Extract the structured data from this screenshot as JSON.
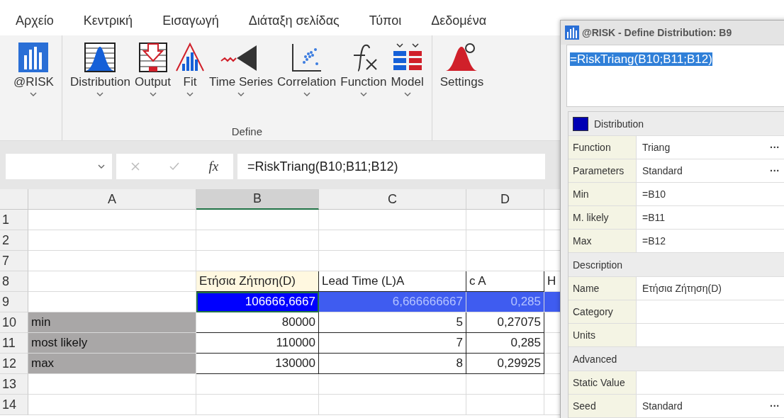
{
  "menu_tabs": [
    "Αρχείο",
    "Κεντρική",
    "Εισαγωγή",
    "Διάταξη σελίδας",
    "Τύποι",
    "Δεδομένα"
  ],
  "ribbon": {
    "buttons": [
      {
        "label": "@RISK",
        "dropdown": true
      },
      {
        "label": "Distribution",
        "dropdown": true
      },
      {
        "label": "Output",
        "dropdown": true
      },
      {
        "label": "Fit",
        "dropdown": true
      },
      {
        "label": "Time Series",
        "dropdown": true
      },
      {
        "label": "Correlation",
        "dropdown": true
      },
      {
        "label": "Function",
        "dropdown": true
      },
      {
        "label": "Model",
        "dropdown": true
      },
      {
        "label": "Settings",
        "dropdown": false
      }
    ],
    "group_label": "Define"
  },
  "formula_bar": {
    "fx": "fx",
    "value": "=RiskTriang(B10;B11;B12)"
  },
  "sheet": {
    "columns": [
      {
        "label": "A",
        "selected": false
      },
      {
        "label": "B",
        "selected": true
      },
      {
        "label": "C",
        "selected": false
      },
      {
        "label": "D",
        "selected": false
      }
    ],
    "rows": [
      {
        "header": "1",
        "cells": [
          {
            "kind": "plain"
          },
          {
            "kind": "plain"
          },
          {
            "kind": "plain"
          },
          {
            "kind": "plain"
          },
          {
            "kind": "plain"
          }
        ]
      },
      {
        "header": "2",
        "cells": [
          {
            "kind": "plain"
          },
          {
            "kind": "plain"
          },
          {
            "kind": "plain"
          },
          {
            "kind": "plain"
          },
          {
            "kind": "plain"
          }
        ]
      },
      {
        "header": "7",
        "cells": [
          {
            "kind": "plain"
          },
          {
            "kind": "plain"
          },
          {
            "kind": "plain"
          },
          {
            "kind": "plain"
          },
          {
            "kind": "plain"
          }
        ]
      },
      {
        "header": "8",
        "cells": [
          {
            "kind": "plain"
          },
          {
            "kind": "heading",
            "text": "Ετήσια Ζήτηση(D)"
          },
          {
            "kind": "boxed_text",
            "text": "Lead Time (L)A"
          },
          {
            "kind": "boxed_text",
            "text": "c A"
          },
          {
            "kind": "plain_text",
            "text": "H"
          }
        ]
      },
      {
        "header": "9",
        "cells": [
          {
            "kind": "plain"
          },
          {
            "kind": "active",
            "text": "106666,6667"
          },
          {
            "kind": "highlight",
            "text": "6,666666667"
          },
          {
            "kind": "highlight",
            "text": "0,285"
          },
          {
            "kind": "highlight"
          }
        ]
      },
      {
        "header": "10",
        "cells": [
          {
            "kind": "label",
            "text": "min"
          },
          {
            "kind": "boxed",
            "text": "80000"
          },
          {
            "kind": "boxed",
            "text": "5"
          },
          {
            "kind": "boxed",
            "text": "0,27075"
          },
          {
            "kind": "plain"
          }
        ]
      },
      {
        "header": "11",
        "cells": [
          {
            "kind": "label",
            "text": "most likely"
          },
          {
            "kind": "boxed",
            "text": "110000"
          },
          {
            "kind": "boxed",
            "text": "7"
          },
          {
            "kind": "boxed",
            "text": "0,285"
          },
          {
            "kind": "plain"
          }
        ]
      },
      {
        "header": "12",
        "cells": [
          {
            "kind": "label",
            "text": "max"
          },
          {
            "kind": "boxed",
            "text": "130000"
          },
          {
            "kind": "boxed",
            "text": "8"
          },
          {
            "kind": "boxed",
            "text": "0,29925"
          },
          {
            "kind": "plain"
          }
        ]
      },
      {
        "header": "13",
        "cells": [
          {
            "kind": "plain"
          },
          {
            "kind": "plain"
          },
          {
            "kind": "plain"
          },
          {
            "kind": "plain"
          },
          {
            "kind": "plain"
          }
        ]
      },
      {
        "header": "14",
        "cells": [
          {
            "kind": "plain"
          },
          {
            "kind": "plain"
          },
          {
            "kind": "plain"
          },
          {
            "kind": "plain"
          },
          {
            "kind": "plain"
          }
        ]
      }
    ]
  },
  "dialog": {
    "title": "@RISK - Define Distribution: B9",
    "formula": "=RiskTriang(B10;B11;B12)",
    "properties": [
      {
        "kind": "section",
        "label": "Distribution",
        "color": "#0000b4"
      },
      {
        "kind": "row",
        "label": "Function",
        "value": "Triang",
        "action": "···"
      },
      {
        "kind": "row",
        "label": "Parameters",
        "value": "Standard",
        "action": "···"
      },
      {
        "kind": "row",
        "label": "Min",
        "value": "=B10"
      },
      {
        "kind": "row",
        "label": "M. likely",
        "value": "=B11"
      },
      {
        "kind": "row",
        "label": "Max",
        "value": "=B12"
      },
      {
        "kind": "section",
        "label": "Description"
      },
      {
        "kind": "row",
        "label": "Name",
        "value": "Ετήσια Ζήτηση(D)"
      },
      {
        "kind": "row",
        "label": "Category"
      },
      {
        "kind": "row",
        "label": "Units"
      },
      {
        "kind": "section",
        "label": "Advanced"
      },
      {
        "kind": "row",
        "label": "Static Value"
      },
      {
        "kind": "row",
        "label": "Seed",
        "value": "Standard",
        "action": "···"
      }
    ]
  }
}
